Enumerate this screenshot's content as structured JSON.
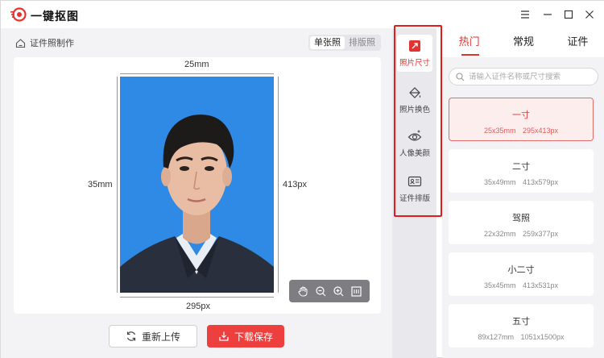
{
  "app": {
    "title": "一键抠图"
  },
  "breadcrumb": {
    "label": "证件照制作"
  },
  "view_toggle": {
    "options": [
      "单张照",
      "排版照"
    ],
    "selected": "单张照"
  },
  "photo": {
    "width_mm": "25mm",
    "height_mm": "35mm",
    "width_px": "295px",
    "height_px": "413px",
    "background_color": "#2f8ae5"
  },
  "zoom_tools": [
    "hand-icon",
    "zoom-out-icon",
    "zoom-in-icon",
    "fit-icon"
  ],
  "actions": {
    "reupload": "重新上传",
    "download": "下载保存"
  },
  "tools": [
    {
      "label": "照片尺寸",
      "icon": "crop-icon",
      "active": true
    },
    {
      "label": "照片换色",
      "icon": "paint-bucket-icon",
      "active": false
    },
    {
      "label": "人像美颜",
      "icon": "eye-sparkle-icon",
      "active": false
    },
    {
      "label": "证件排版",
      "icon": "id-card-icon",
      "active": false
    }
  ],
  "tabs": [
    {
      "label": "热门",
      "active": true
    },
    {
      "label": "常规",
      "active": false
    },
    {
      "label": "证件",
      "active": false
    }
  ],
  "search": {
    "placeholder": "请输入证件名称或尺寸搜索",
    "value": ""
  },
  "sizes": [
    {
      "name": "一寸",
      "mm": "25x35mm",
      "px": "295x413px",
      "selected": true
    },
    {
      "name": "二寸",
      "mm": "35x49mm",
      "px": "413x579px",
      "selected": false
    },
    {
      "name": "驾照",
      "mm": "22x32mm",
      "px": "259x377px",
      "selected": false
    },
    {
      "name": "小二寸",
      "mm": "35x45mm",
      "px": "413x531px",
      "selected": false
    },
    {
      "name": "五寸",
      "mm": "89x127mm",
      "px": "1051x1500px",
      "selected": false
    }
  ],
  "colors": {
    "accent": "#e23232",
    "download_button": "#ee3f3f",
    "highlight_border": "#e21b1b"
  }
}
